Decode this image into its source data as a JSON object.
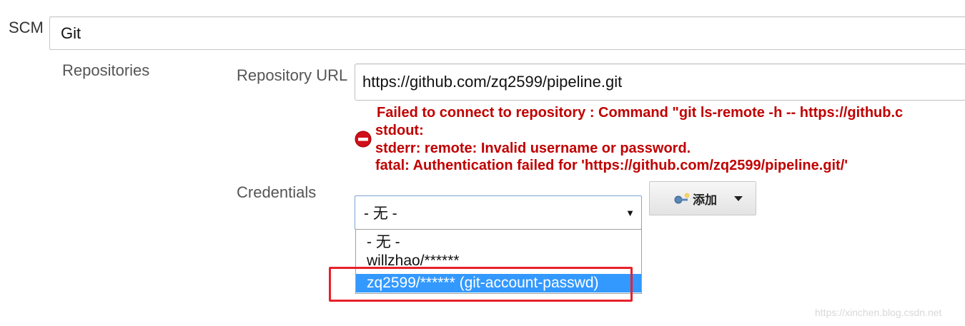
{
  "scm": {
    "label": "SCM",
    "value": "Git"
  },
  "repositories": {
    "label": "Repositories",
    "url_label": "Repository URL",
    "url_value": "https://github.com/zq2599/pipeline.git",
    "error": {
      "line1": "Failed to connect to repository : Command \"git ls-remote -h -- https://github.c",
      "line2": "stdout:",
      "line3": "stderr: remote: Invalid username or password.",
      "line4": "fatal: Authentication failed for 'https://github.com/zq2599/pipeline.git/'"
    },
    "error_icon": "error-stop-icon",
    "error_color": "#c00000"
  },
  "credentials": {
    "label": "Credentials",
    "selected": "- 无 -",
    "dropdown_arrow": "▼",
    "options": [
      "- 无 -",
      "willzhao/******",
      "zq2599/****** (git-account-passwd)"
    ],
    "highlighted_index": 2,
    "highlight_color": "#3399ff",
    "add_button": {
      "label": "添加",
      "icon": "key-add-icon"
    }
  },
  "annotation_color": "#e8212b",
  "watermark": "https://xinchen.blog.csdn.net"
}
